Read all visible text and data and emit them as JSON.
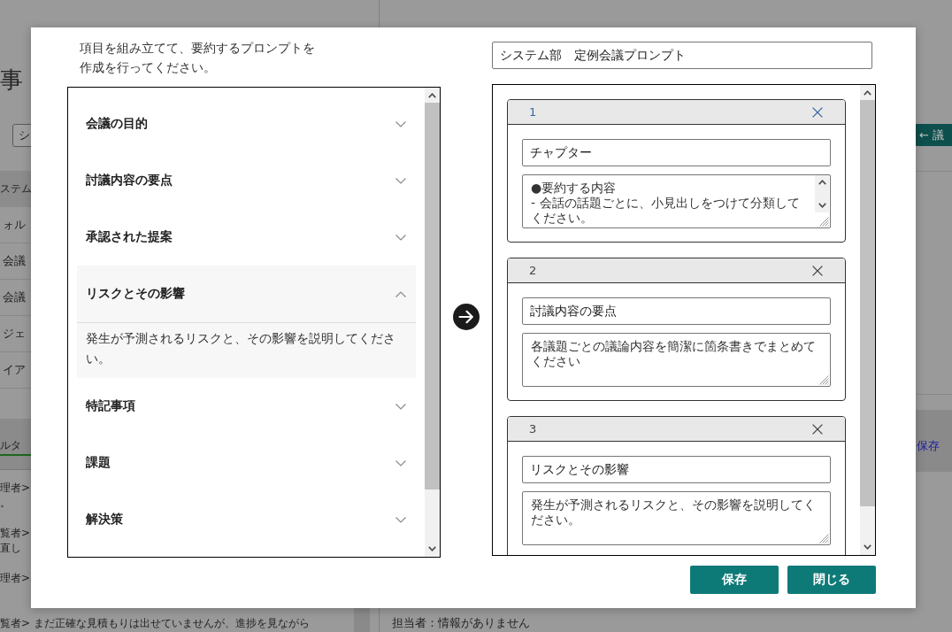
{
  "background_page": {
    "title": "事",
    "filter": {
      "value": "シ"
    },
    "list_header": "ステム",
    "list_items": [
      "ォル",
      "会議",
      "会議",
      "ジェ",
      "イア"
    ],
    "tabs": [
      {
        "label": "ルタ",
        "selected": true
      }
    ],
    "comments": [
      {
        "lines": [
          "理者>",
          "。"
        ]
      },
      {
        "lines": [
          "覧者>",
          "直し"
        ]
      },
      {
        "lines": [
          "理者>"
        ]
      },
      {
        "lines": [
          "覧者> まだ正確な見積もりは出せていませんが、進捗を見ながら"
        ]
      }
    ],
    "back_button": "← 議",
    "save_link": "保存",
    "detail_line": "担当者：情報がありません"
  },
  "dialog": {
    "instruction": "項目を組み立てて、要約するプロンプトを作成を行ってください。",
    "sections": [
      {
        "label": "会議の目的",
        "expanded": false
      },
      {
        "label": "討議内容の要点",
        "expanded": false
      },
      {
        "label": "承認された提案",
        "expanded": false
      },
      {
        "label": "リスクとその影響",
        "expanded": true,
        "description": "発生が予測されるリスクと、その影響を説明してください。"
      },
      {
        "label": "特記事項",
        "expanded": false
      },
      {
        "label": "課題",
        "expanded": false
      },
      {
        "label": "解決策",
        "expanded": false
      }
    ],
    "prompt_name": {
      "value": "システム部　定例会議プロンプト"
    },
    "chapters": [
      {
        "number": "1",
        "active": true,
        "title": "チャプター",
        "content": "●要約する内容\n- 会話の話題ごとに、小見出しをつけて分類してください。"
      },
      {
        "number": "2",
        "active": false,
        "title": "討議内容の要点",
        "content": "各議題ごとの議論内容を簡潔に箇条書きでまとめてください"
      },
      {
        "number": "3",
        "active": false,
        "title": "リスクとその影響",
        "content": "発生が予測されるリスクと、その影響を説明してください。"
      }
    ],
    "buttons": [
      {
        "label": "保存"
      },
      {
        "label": "閉じる"
      }
    ]
  }
}
